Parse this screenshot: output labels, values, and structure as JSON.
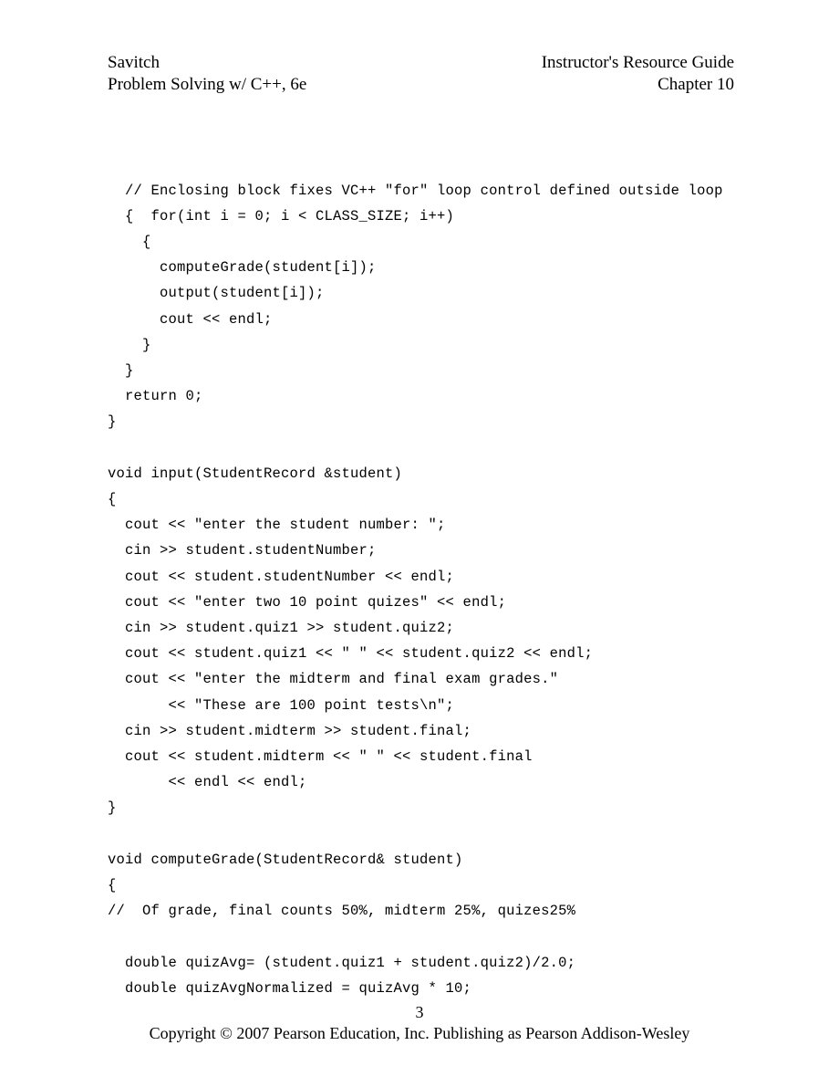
{
  "header": {
    "left_line1": "Savitch",
    "left_line2": "Problem  Solving w/ C++, 6e",
    "right_line1": "Instructor's Resource Guide",
    "right_line2": "Chapter 10"
  },
  "code": "  // Enclosing block fixes VC++ \"for\" loop control defined outside loop\n  {  for(int i = 0; i < CLASS_SIZE; i++)\n    {\n      computeGrade(student[i]);\n      output(student[i]);\n      cout << endl;\n    }\n  }\n  return 0;\n}\n\nvoid input(StudentRecord &student)\n{\n  cout << \"enter the student number: \";\n  cin >> student.studentNumber;\n  cout << student.studentNumber << endl;\n  cout << \"enter two 10 point quizes\" << endl;\n  cin >> student.quiz1 >> student.quiz2;\n  cout << student.quiz1 << \" \" << student.quiz2 << endl;\n  cout << \"enter the midterm and final exam grades.\"\n       << \"These are 100 point tests\\n\";\n  cin >> student.midterm >> student.final;\n  cout << student.midterm << \" \" << student.final\n       << endl << endl;\n}\n\nvoid computeGrade(StudentRecord& student)\n{\n//  Of grade, final counts 50%, midterm 25%, quizes25%\n\n  double quizAvg= (student.quiz1 + student.quiz2)/2.0;\n  double quizAvgNormalized = quizAvg * 10;",
  "footer": {
    "page_number": "3",
    "copyright": "Copyright © 2007 Pearson Education, Inc. Publishing as Pearson Addison-Wesley"
  }
}
